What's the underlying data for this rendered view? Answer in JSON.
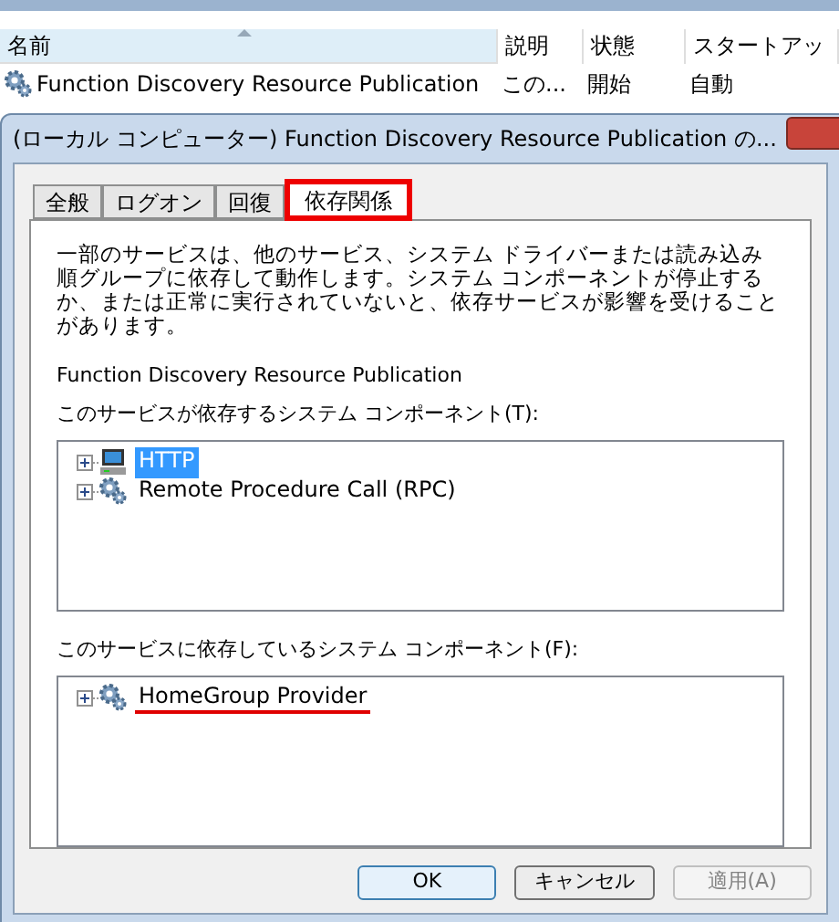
{
  "list": {
    "columns": [
      {
        "label": "名前",
        "sorted": true
      },
      {
        "label": "説明",
        "sorted": false
      },
      {
        "label": "状態",
        "sorted": false
      },
      {
        "label": "スタートアッ",
        "sorted": false
      }
    ],
    "rows": [
      {
        "cells": [
          "Function Discovery Resource Publication",
          "この...",
          "開始",
          "自動"
        ]
      }
    ]
  },
  "dialog": {
    "title": "(ローカル コンピューター) Function Discovery Resource Publication の...",
    "tabs": [
      {
        "label": "全般",
        "selected": false,
        "highlighted": false
      },
      {
        "label": "ログオン",
        "selected": false,
        "highlighted": false
      },
      {
        "label": "回復",
        "selected": false,
        "highlighted": false
      },
      {
        "label": "依存関係",
        "selected": true,
        "highlighted": true
      }
    ],
    "description": "一部のサービスは、他のサービス、システム ドライバーまたは読み込み順グループに依存して動作します。システム コンポーネントが停止するか、または正常に実行されていないと、依存サービスが影響を受けることがあります。",
    "service_name": "Function Discovery Resource Publication",
    "depends_on_label": "このサービスが依存するシステム コンポーネント(T):",
    "depends_on": [
      {
        "kind": "computer",
        "label": "HTTP",
        "selected": true,
        "underlined": false
      },
      {
        "kind": "gear",
        "label": "Remote Procedure Call (RPC)",
        "selected": false,
        "underlined": false
      }
    ],
    "dependents_label": "このサービスに依存しているシステム コンポーネント(F):",
    "dependents": [
      {
        "kind": "gear",
        "label": "HomeGroup Provider",
        "selected": false,
        "underlined": true
      }
    ],
    "buttons": [
      {
        "label": "OK",
        "default": true,
        "disabled": false
      },
      {
        "label": "キャンセル",
        "default": false,
        "disabled": false
      },
      {
        "label": "適用(A)",
        "default": false,
        "disabled": true
      }
    ]
  }
}
